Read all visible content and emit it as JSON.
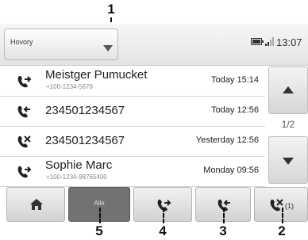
{
  "callouts": [
    "1",
    "5",
    "4",
    "3",
    "2"
  ],
  "header": {
    "dropdown_label": "Hovory",
    "time": "13:07"
  },
  "calls": [
    {
      "name": "Meistger Pumucket",
      "number": "+100-1234-5678",
      "time": "Today 15:14",
      "type": "outgoing"
    },
    {
      "name": "234501234567",
      "number": "",
      "time": "Today 12:56",
      "type": "incoming"
    },
    {
      "name": "234501234567",
      "number": "",
      "time": "Yesterday 12:56",
      "type": "missed"
    },
    {
      "name": "Sophie Marc",
      "number": "+100-1234-98765400",
      "time": "Monday 09:56",
      "type": "outgoing"
    }
  ],
  "scroll": {
    "page_indicator": "1/2"
  },
  "tabs": {
    "home_icon": "home-icon",
    "all_label": "Alle",
    "outgoing_icon": "outgoing-call-icon",
    "incoming_icon": "incoming-call-icon",
    "missed_icon": "missed-call-icon",
    "missed_count": "(1)"
  },
  "colors": {
    "icon": "#222222",
    "active_tab": "#727272"
  }
}
